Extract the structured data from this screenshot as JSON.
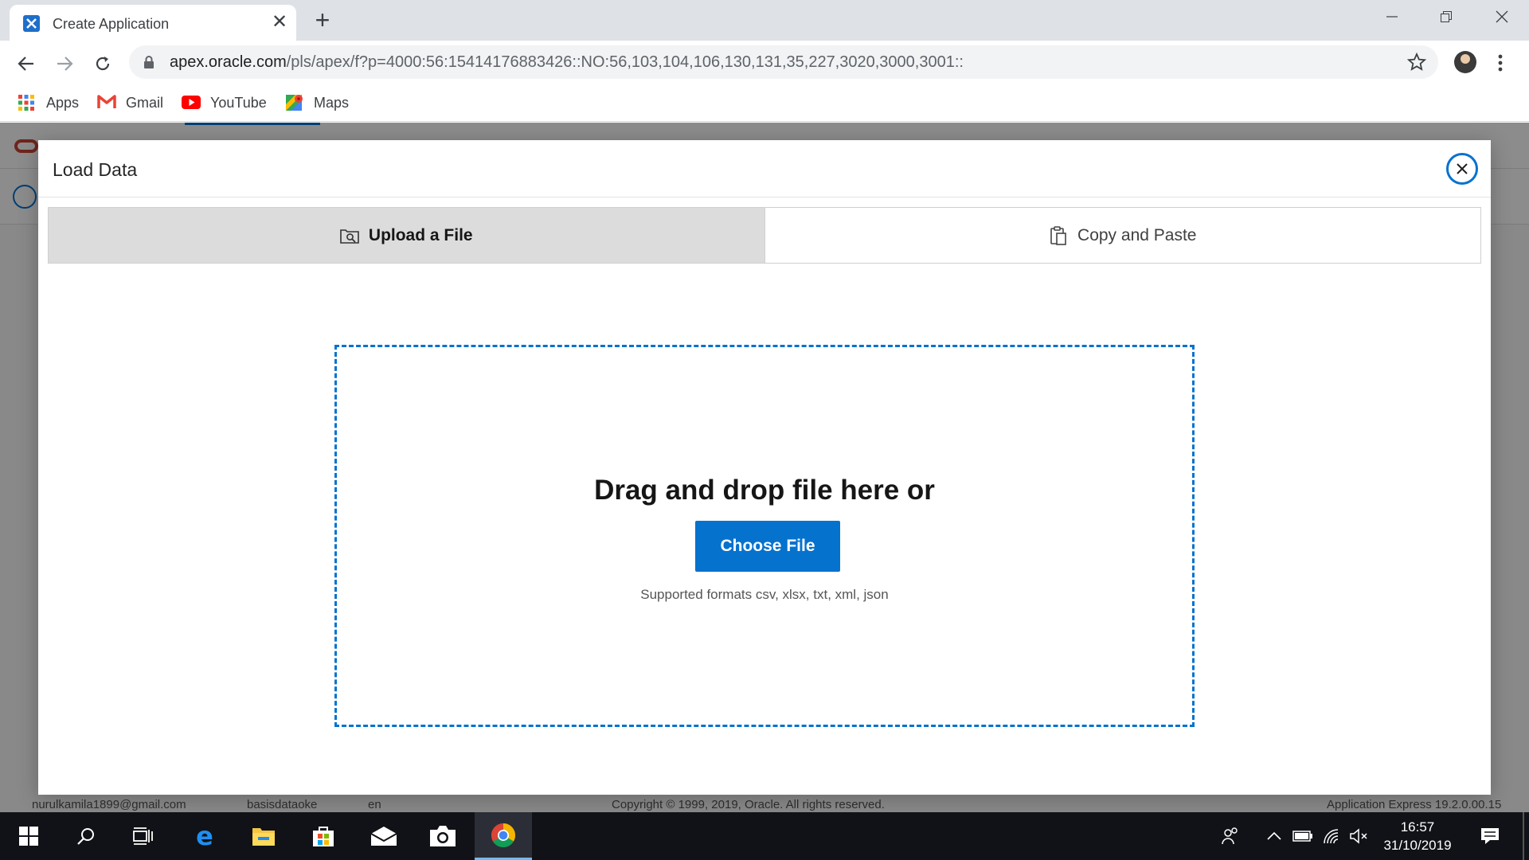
{
  "browser": {
    "tab_title": "Create Application",
    "tab_close": "✕",
    "new_tab": "+",
    "url_host": "apex.oracle.com",
    "url_path": "/pls/apex/f?p=4000:56:15414176883426::NO:56,103,104,106,130,131,35,227,3020,3000,3001::",
    "bookmarks": [
      {
        "label": "Apps",
        "icon": "apps-grid-icon"
      },
      {
        "label": "Gmail",
        "icon": "gmail-icon"
      },
      {
        "label": "YouTube",
        "icon": "youtube-icon"
      },
      {
        "label": "Maps",
        "icon": "maps-icon"
      }
    ]
  },
  "background_page": {
    "footer_user": "nurulkamila1899@gmail.com",
    "footer_workspace": "basisdataoke",
    "footer_language": "en",
    "footer_copyright": "Copyright © 1999, 2019, Oracle. All rights reserved.",
    "footer_version": "Application Express 19.2.0.00.15"
  },
  "dialog": {
    "title": "Load Data",
    "close_icon": "close-icon",
    "tabs": [
      {
        "label": "Upload a File",
        "icon": "upload-file-icon",
        "active": true
      },
      {
        "label": "Copy and Paste",
        "icon": "clipboard-icon",
        "active": false
      }
    ],
    "dropzone": {
      "title": "Drag and drop file here or",
      "button_label": "Choose File",
      "formats": "Supported formats csv, xlsx, txt, xml, json"
    }
  },
  "taskbar": {
    "time": "16:57",
    "date": "31/10/2019"
  },
  "colors": {
    "accent": "#0572ce",
    "oracle_red": "#c74634",
    "taskbar": "#101217"
  }
}
